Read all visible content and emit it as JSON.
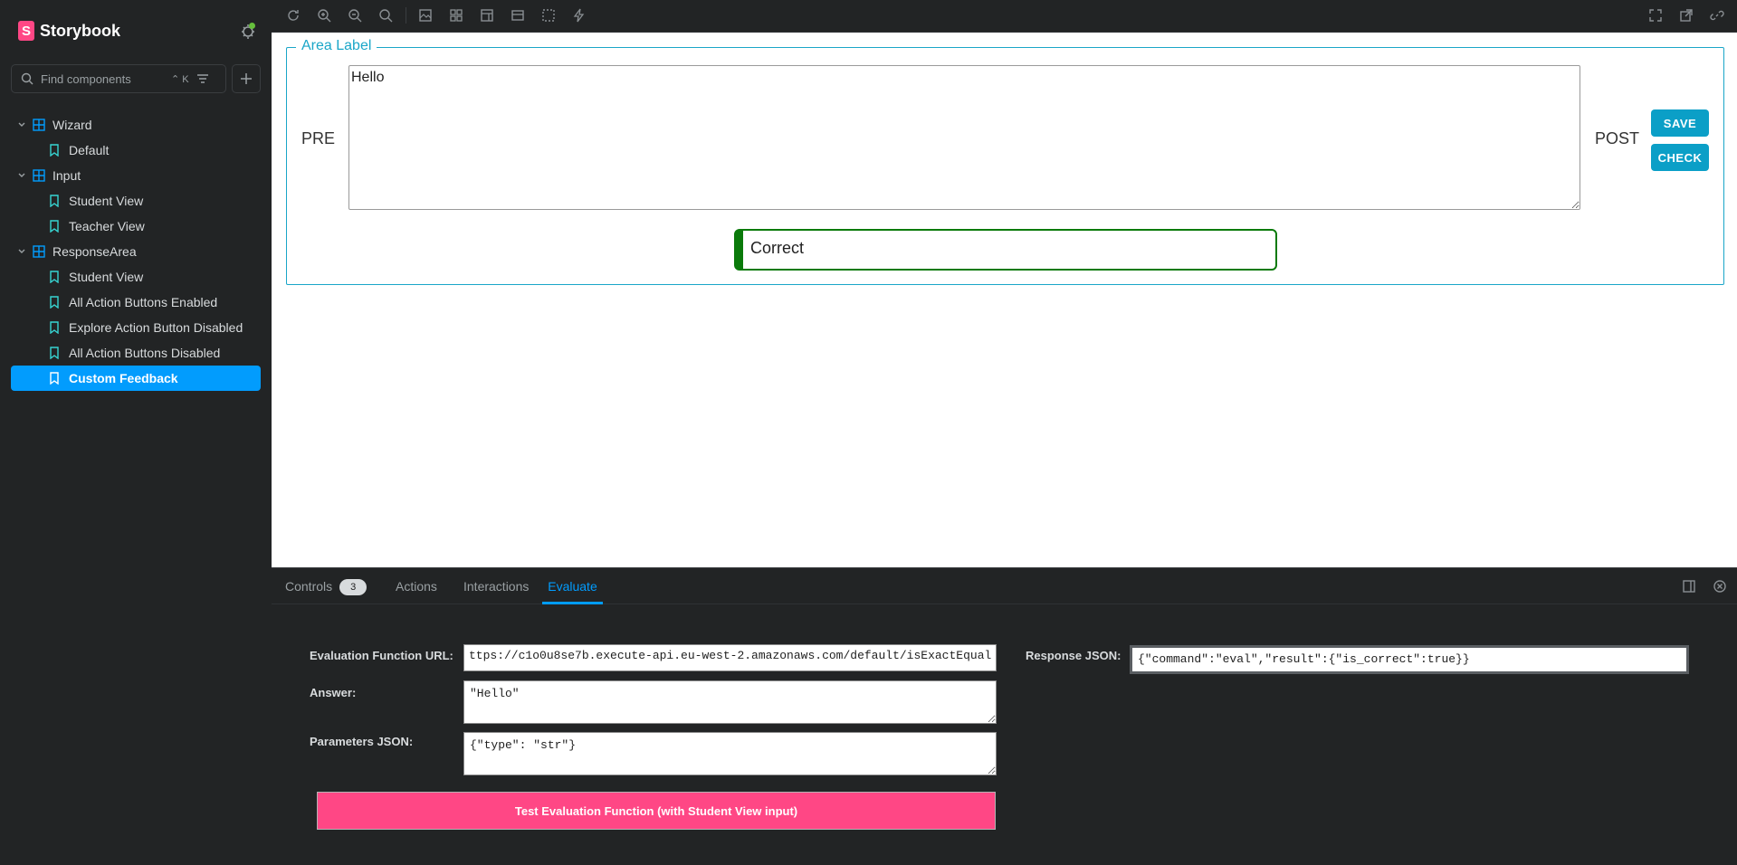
{
  "app": {
    "name": "Storybook",
    "logo_letter": "S"
  },
  "search": {
    "placeholder": "Find components",
    "shortcut": "⌃ K"
  },
  "tree": {
    "groups": [
      {
        "label": "Wizard",
        "stories": [
          "Default"
        ]
      },
      {
        "label": "Input",
        "stories": [
          "Student View",
          "Teacher View"
        ]
      },
      {
        "label": "ResponseArea",
        "stories": [
          "Student View",
          "All Action Buttons Enabled",
          "Explore Action Button Disabled",
          "All Action Buttons Disabled",
          "Custom Feedback"
        ]
      }
    ],
    "selected": "Custom Feedback"
  },
  "canvas": {
    "legend": "Area Label",
    "pre": "PRE",
    "answer_value": "Hello",
    "post": "POST",
    "save_label": "SAVE",
    "check_label": "CHECK",
    "feedback": "Correct"
  },
  "panel": {
    "tabs": [
      {
        "label": "Controls",
        "badge": "3"
      },
      {
        "label": "Actions"
      },
      {
        "label": "Interactions"
      },
      {
        "label": "Evaluate"
      }
    ],
    "active_tab": "Evaluate",
    "url_label": "Evaluation Function URL:",
    "url_value": "ttps://c1o0u8se7b.execute-api.eu-west-2.amazonaws.com/default/isExactEqual",
    "answer_label": "Answer:",
    "answer_value": "\"Hello\"",
    "params_label": "Parameters JSON:",
    "params_value": "{\"type\": \"str\"}",
    "response_label": "Response JSON:",
    "response_value": "{\"command\":\"eval\",\"result\":{\"is_correct\":true}}",
    "test_button": "Test Evaluation Function (with Student View input)"
  },
  "colors": {
    "accent": "#029cfd",
    "brand": "#ff4785",
    "correct": "#0a7a0a",
    "button": "#0b9fc7"
  }
}
